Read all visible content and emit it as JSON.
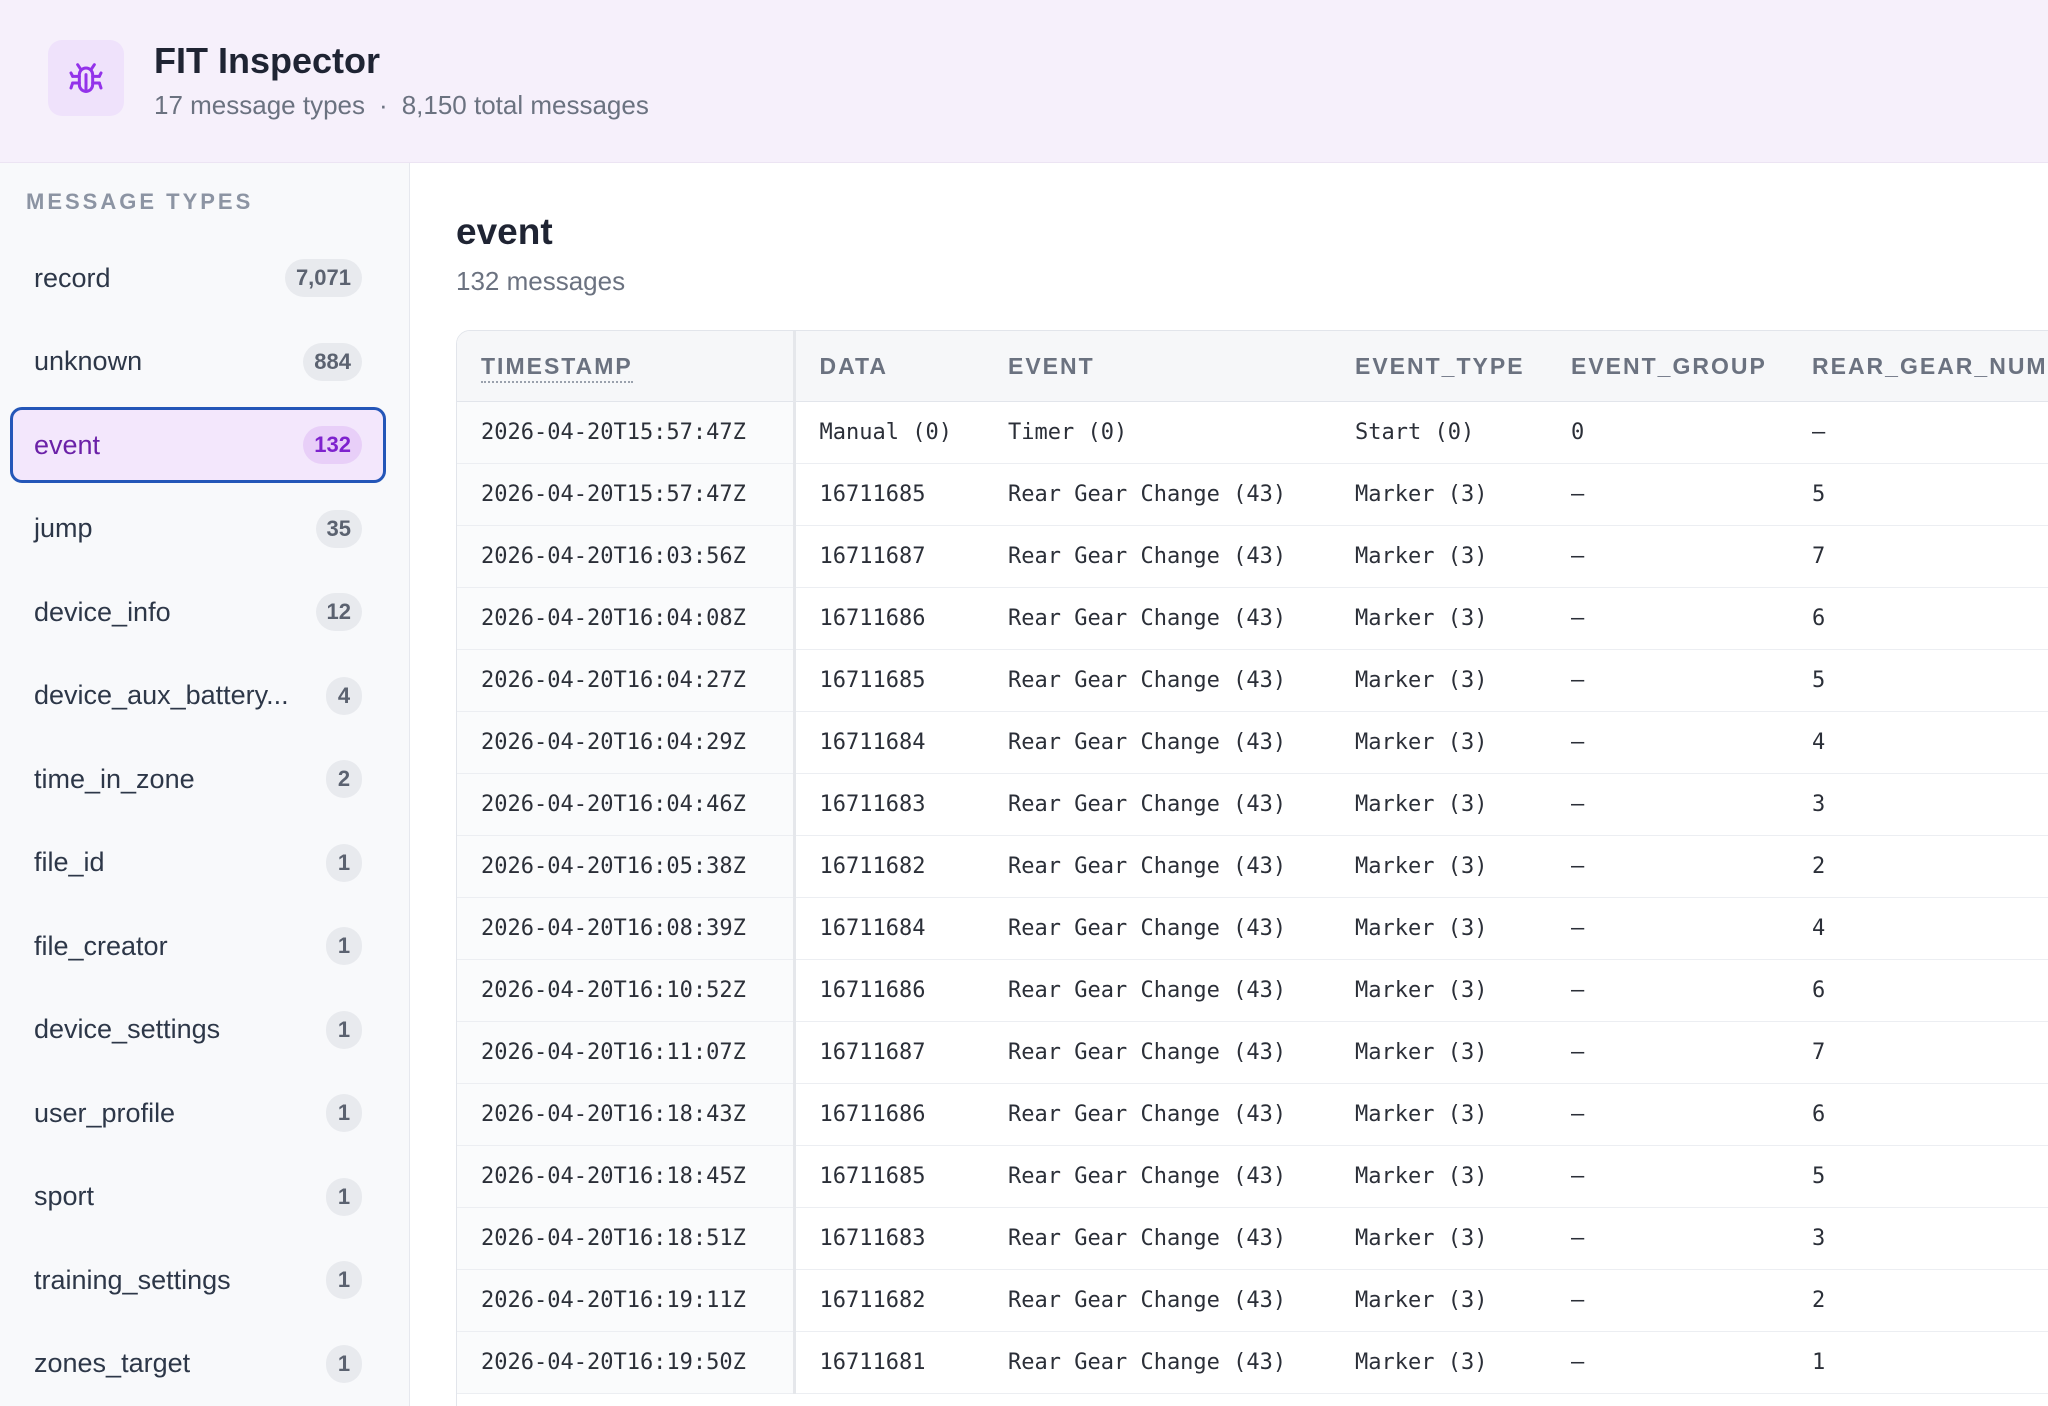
{
  "app": {
    "title": "FIT Inspector",
    "type_count_text": "17 message types",
    "separator": "·",
    "total_messages_text": "8,150 total messages",
    "accent": "#9333ea",
    "logo_icon": "bug-icon"
  },
  "sidebar": {
    "heading": "MESSAGE TYPES",
    "selected": "event",
    "items": [
      {
        "label": "record",
        "count": "7,071"
      },
      {
        "label": "unknown",
        "count": "884"
      },
      {
        "label": "event",
        "count": "132"
      },
      {
        "label": "jump",
        "count": "35"
      },
      {
        "label": "device_info",
        "count": "12"
      },
      {
        "label": "device_aux_battery...",
        "count": "4"
      },
      {
        "label": "time_in_zone",
        "count": "2"
      },
      {
        "label": "file_id",
        "count": "1"
      },
      {
        "label": "file_creator",
        "count": "1"
      },
      {
        "label": "device_settings",
        "count": "1"
      },
      {
        "label": "user_profile",
        "count": "1"
      },
      {
        "label": "sport",
        "count": "1"
      },
      {
        "label": "training_settings",
        "count": "1"
      },
      {
        "label": "zones_target",
        "count": "1"
      }
    ]
  },
  "main": {
    "title": "event",
    "subtitle": "132 messages",
    "columns": [
      "TIMESTAMP",
      "DATA",
      "EVENT",
      "EVENT_TYPE",
      "EVENT_GROUP",
      "REAR_GEAR_NUM"
    ],
    "rows": [
      [
        "2026-04-20T15:57:47Z",
        "Manual (0)",
        "Timer (0)",
        "Start (0)",
        "0",
        "–"
      ],
      [
        "2026-04-20T15:57:47Z",
        "16711685",
        "Rear Gear Change (43)",
        "Marker (3)",
        "–",
        "5"
      ],
      [
        "2026-04-20T16:03:56Z",
        "16711687",
        "Rear Gear Change (43)",
        "Marker (3)",
        "–",
        "7"
      ],
      [
        "2026-04-20T16:04:08Z",
        "16711686",
        "Rear Gear Change (43)",
        "Marker (3)",
        "–",
        "6"
      ],
      [
        "2026-04-20T16:04:27Z",
        "16711685",
        "Rear Gear Change (43)",
        "Marker (3)",
        "–",
        "5"
      ],
      [
        "2026-04-20T16:04:29Z",
        "16711684",
        "Rear Gear Change (43)",
        "Marker (3)",
        "–",
        "4"
      ],
      [
        "2026-04-20T16:04:46Z",
        "16711683",
        "Rear Gear Change (43)",
        "Marker (3)",
        "–",
        "3"
      ],
      [
        "2026-04-20T16:05:38Z",
        "16711682",
        "Rear Gear Change (43)",
        "Marker (3)",
        "–",
        "2"
      ],
      [
        "2026-04-20T16:08:39Z",
        "16711684",
        "Rear Gear Change (43)",
        "Marker (3)",
        "–",
        "4"
      ],
      [
        "2026-04-20T16:10:52Z",
        "16711686",
        "Rear Gear Change (43)",
        "Marker (3)",
        "–",
        "6"
      ],
      [
        "2026-04-20T16:11:07Z",
        "16711687",
        "Rear Gear Change (43)",
        "Marker (3)",
        "–",
        "7"
      ],
      [
        "2026-04-20T16:18:43Z",
        "16711686",
        "Rear Gear Change (43)",
        "Marker (3)",
        "–",
        "6"
      ],
      [
        "2026-04-20T16:18:45Z",
        "16711685",
        "Rear Gear Change (43)",
        "Marker (3)",
        "–",
        "5"
      ],
      [
        "2026-04-20T16:18:51Z",
        "16711683",
        "Rear Gear Change (43)",
        "Marker (3)",
        "–",
        "3"
      ],
      [
        "2026-04-20T16:19:11Z",
        "16711682",
        "Rear Gear Change (43)",
        "Marker (3)",
        "–",
        "2"
      ],
      [
        "2026-04-20T16:19:50Z",
        "16711681",
        "Rear Gear Change (43)",
        "Marker (3)",
        "–",
        "1"
      ]
    ]
  }
}
